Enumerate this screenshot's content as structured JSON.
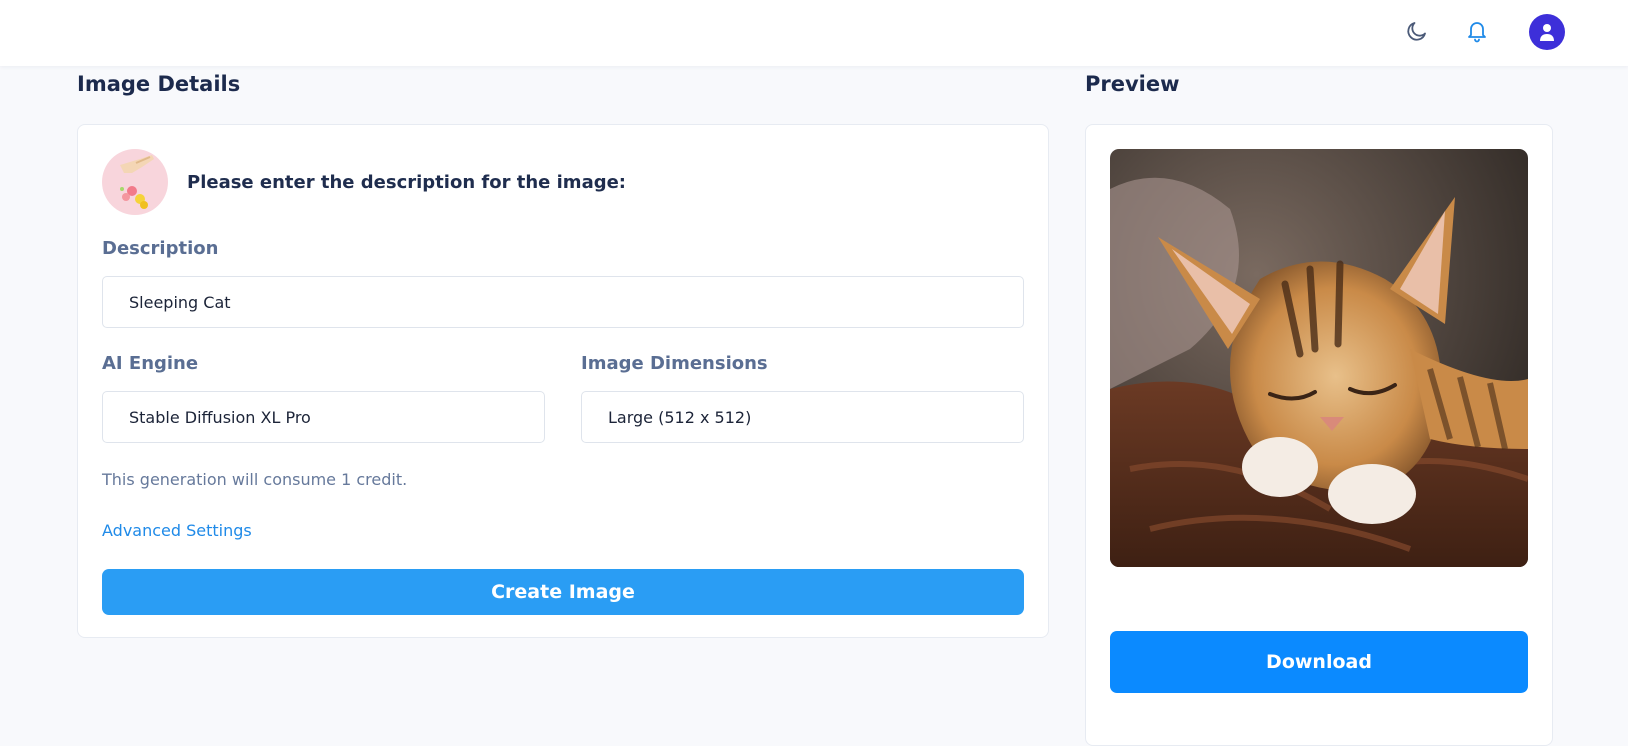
{
  "header": {
    "icons": [
      "moon-icon",
      "bell-icon",
      "user-icon"
    ],
    "colors": {
      "avatar": "#3d2fd9",
      "bell": "#1f8ae8",
      "moon": "#4b5a78"
    }
  },
  "details": {
    "title": "Image Details",
    "prompt": "Please enter the description for the image:",
    "description_label": "Description",
    "description_value": "Sleeping Cat",
    "engine_label": "AI Engine",
    "engine_value": "Stable Diffusion XL Pro",
    "dimensions_label": "Image Dimensions",
    "dimensions_value": "Large (512 x 512)",
    "credit_note": "This generation will consume 1 credit.",
    "advanced_link": "Advanced Settings",
    "create_button": "Create Image",
    "colors": {
      "create_button": "#2a9df4",
      "link": "#1f8ae8"
    }
  },
  "preview": {
    "title": "Preview",
    "download_button": "Download",
    "colors": {
      "download_button": "#0b8aff"
    }
  }
}
